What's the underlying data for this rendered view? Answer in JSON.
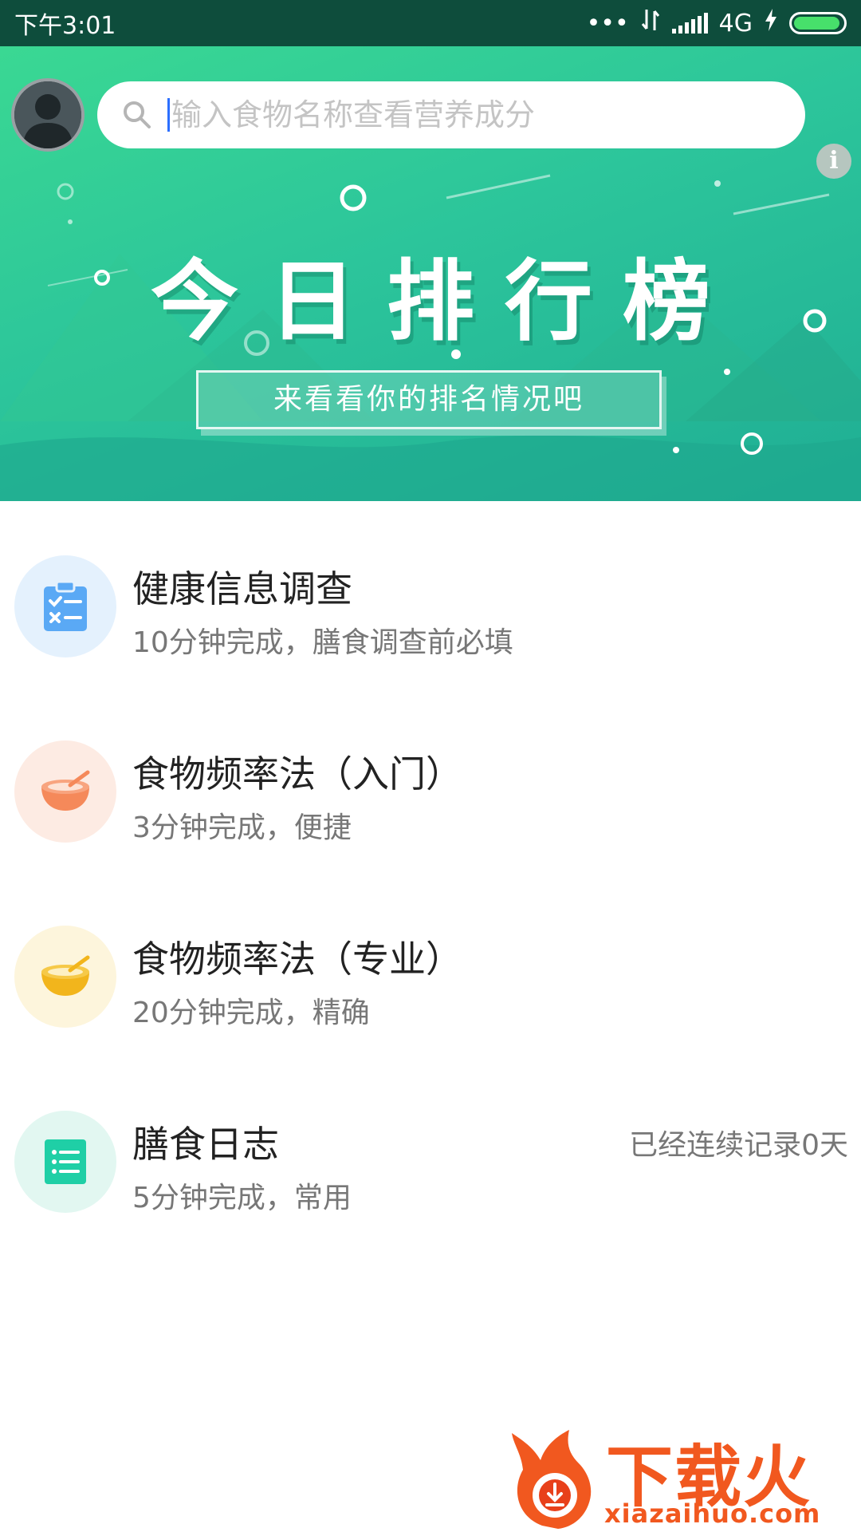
{
  "status_bar": {
    "time": "下午3:01",
    "dots": "•••",
    "network": "4G",
    "battery_level": 0.95
  },
  "search": {
    "placeholder": "输入食物名称查看营养成分",
    "value": ""
  },
  "banner": {
    "title": "今日排行榜",
    "subtitle": "来看看你的排名情况吧"
  },
  "list": {
    "items": [
      {
        "title": "健康信息调查",
        "subtitle": "10分钟完成，膳食调查前必填",
        "icon": "clipboard-checklist-icon",
        "icon_color": "#5aa9f5",
        "bg_color": "#e4f1fd"
      },
      {
        "title": "食物频率法（入门）",
        "subtitle": "3分钟完成，便捷",
        "icon": "bowl-icon",
        "icon_color": "#f5895a",
        "bg_color": "#fdebe3"
      },
      {
        "title": "食物频率法（专业）",
        "subtitle": "20分钟完成，精确",
        "icon": "bowl-icon",
        "icon_color": "#f2b51c",
        "bg_color": "#fdf5dc"
      },
      {
        "title": "膳食日志",
        "subtitle": "5分钟完成，常用",
        "extra": "已经连续记录0天",
        "icon": "list-icon",
        "icon_color": "#1fcfa6",
        "bg_color": "#e2f7f1"
      }
    ]
  },
  "watermark": {
    "text": "下载火",
    "domain": "xiazaihuo.com"
  },
  "colors": {
    "status_bar": "#0e4d3c",
    "banner_start": "#3ad893",
    "banner_end": "#1fae94",
    "watermark": "#f1581f"
  }
}
